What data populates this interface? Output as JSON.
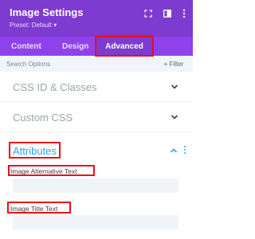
{
  "header": {
    "title": "Image Settings",
    "preset": "Preset: Default ▾",
    "icons": [
      "expand-icon",
      "sidebar-toggle-icon",
      "kebab-menu-icon"
    ],
    "background": "#7e3bd0"
  },
  "tabs": [
    {
      "label": "Content",
      "active": false
    },
    {
      "label": "Design",
      "active": false
    },
    {
      "label": "Advanced",
      "active": true
    }
  ],
  "search": {
    "placeholder": "Search Options",
    "filter_label": "+ Filter"
  },
  "sections": [
    {
      "label": "CSS ID & Classes",
      "expanded": false
    },
    {
      "label": "Custom CSS",
      "expanded": false
    },
    {
      "label": "Attributes",
      "expanded": true
    }
  ],
  "attributes": {
    "alt_label": "Image Alternative Text",
    "alt_value": "",
    "title_label": "Image Title Text",
    "title_value": ""
  },
  "colors": {
    "accent": "#2ea3f2",
    "tab_bar": "#8f42ec",
    "annotation": "#e8101b"
  }
}
